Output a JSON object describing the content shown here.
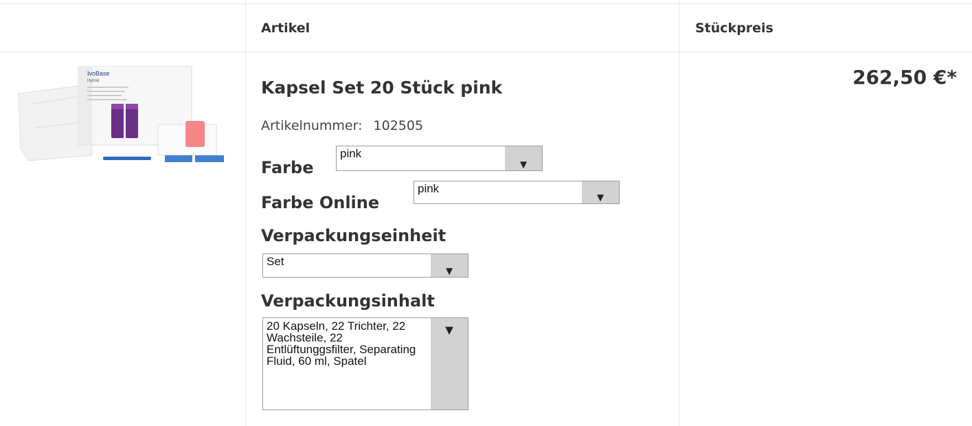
{
  "table": {
    "headers": {
      "col1": "",
      "col2": "Artikel",
      "col3": "Stückpreis"
    }
  },
  "product": {
    "image_alt": "IvoBase Hybrid Kapsel Set",
    "image_brand": "IvoBase",
    "image_sub": "Hybrid",
    "title": "Kapsel Set 20 Stück pink",
    "article_number_label": "Artikelnummer:",
    "article_number": "102505",
    "price": "262,50 €*"
  },
  "options": {
    "farbe": {
      "label": "Farbe",
      "value": "pink"
    },
    "farbe_online": {
      "label": "Farbe Online",
      "value": "pink"
    },
    "verpackungseinheit": {
      "label": "Verpackungseinheit",
      "value": "Set"
    },
    "verpackungsinhalt": {
      "label": "Verpackungsinhalt",
      "value": "20 Kapseln, 22 Trichter, 22 Wachsteile, 22 Entlüftunggsfilter, Separating Fluid, 60 ml, Spatel"
    }
  },
  "icons": {
    "dropdown": "triangle-down-icon"
  }
}
